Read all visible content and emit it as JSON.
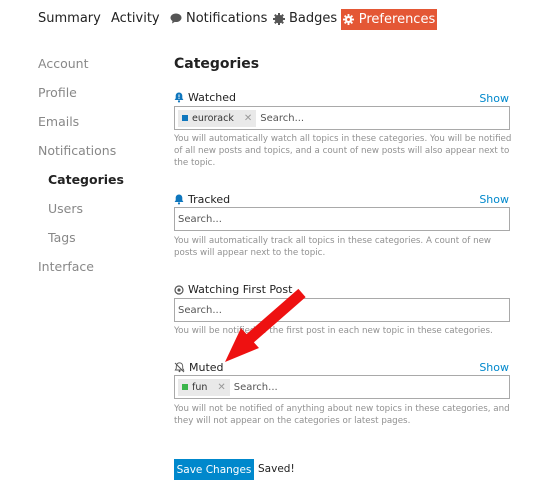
{
  "nav": {
    "summary": "Summary",
    "activity": "Activity",
    "notifications": "Notifications",
    "badges": "Badges",
    "preferences": "Preferences",
    "active_color": "#e45735"
  },
  "sidebar": {
    "items": [
      "Account",
      "Profile",
      "Emails",
      "Notifications",
      "Categories",
      "Users",
      "Tags",
      "Interface"
    ],
    "active": "Categories"
  },
  "main": {
    "heading": "Categories",
    "show_label": "Show",
    "search_placeholder": "Search...",
    "watched": {
      "label": "Watched",
      "chip": {
        "name": "eurorack",
        "color": "#0e76bd"
      },
      "description": "You will automatically watch all topics in these categories. You will be notified of all new posts and topics, and a count of new posts will also appear next to the topic."
    },
    "tracked": {
      "label": "Tracked",
      "description": "You will automatically track all topics in these categories. A count of new posts will appear next to the topic."
    },
    "watching_first": {
      "label": "Watching First Post",
      "description": "You will be notified of the first post in each new topic in these categories."
    },
    "muted": {
      "label": "Muted",
      "chip": {
        "name": "fun",
        "color": "#3ab54a"
      },
      "description": "You will not be notified of anything about new topics in these categories, and they will not appear on the categories or latest pages."
    },
    "save_label": "Save Changes",
    "saved_text": "Saved!",
    "accent": "#0088cc"
  },
  "annotation": {
    "arrow_color": "#ee1111"
  }
}
